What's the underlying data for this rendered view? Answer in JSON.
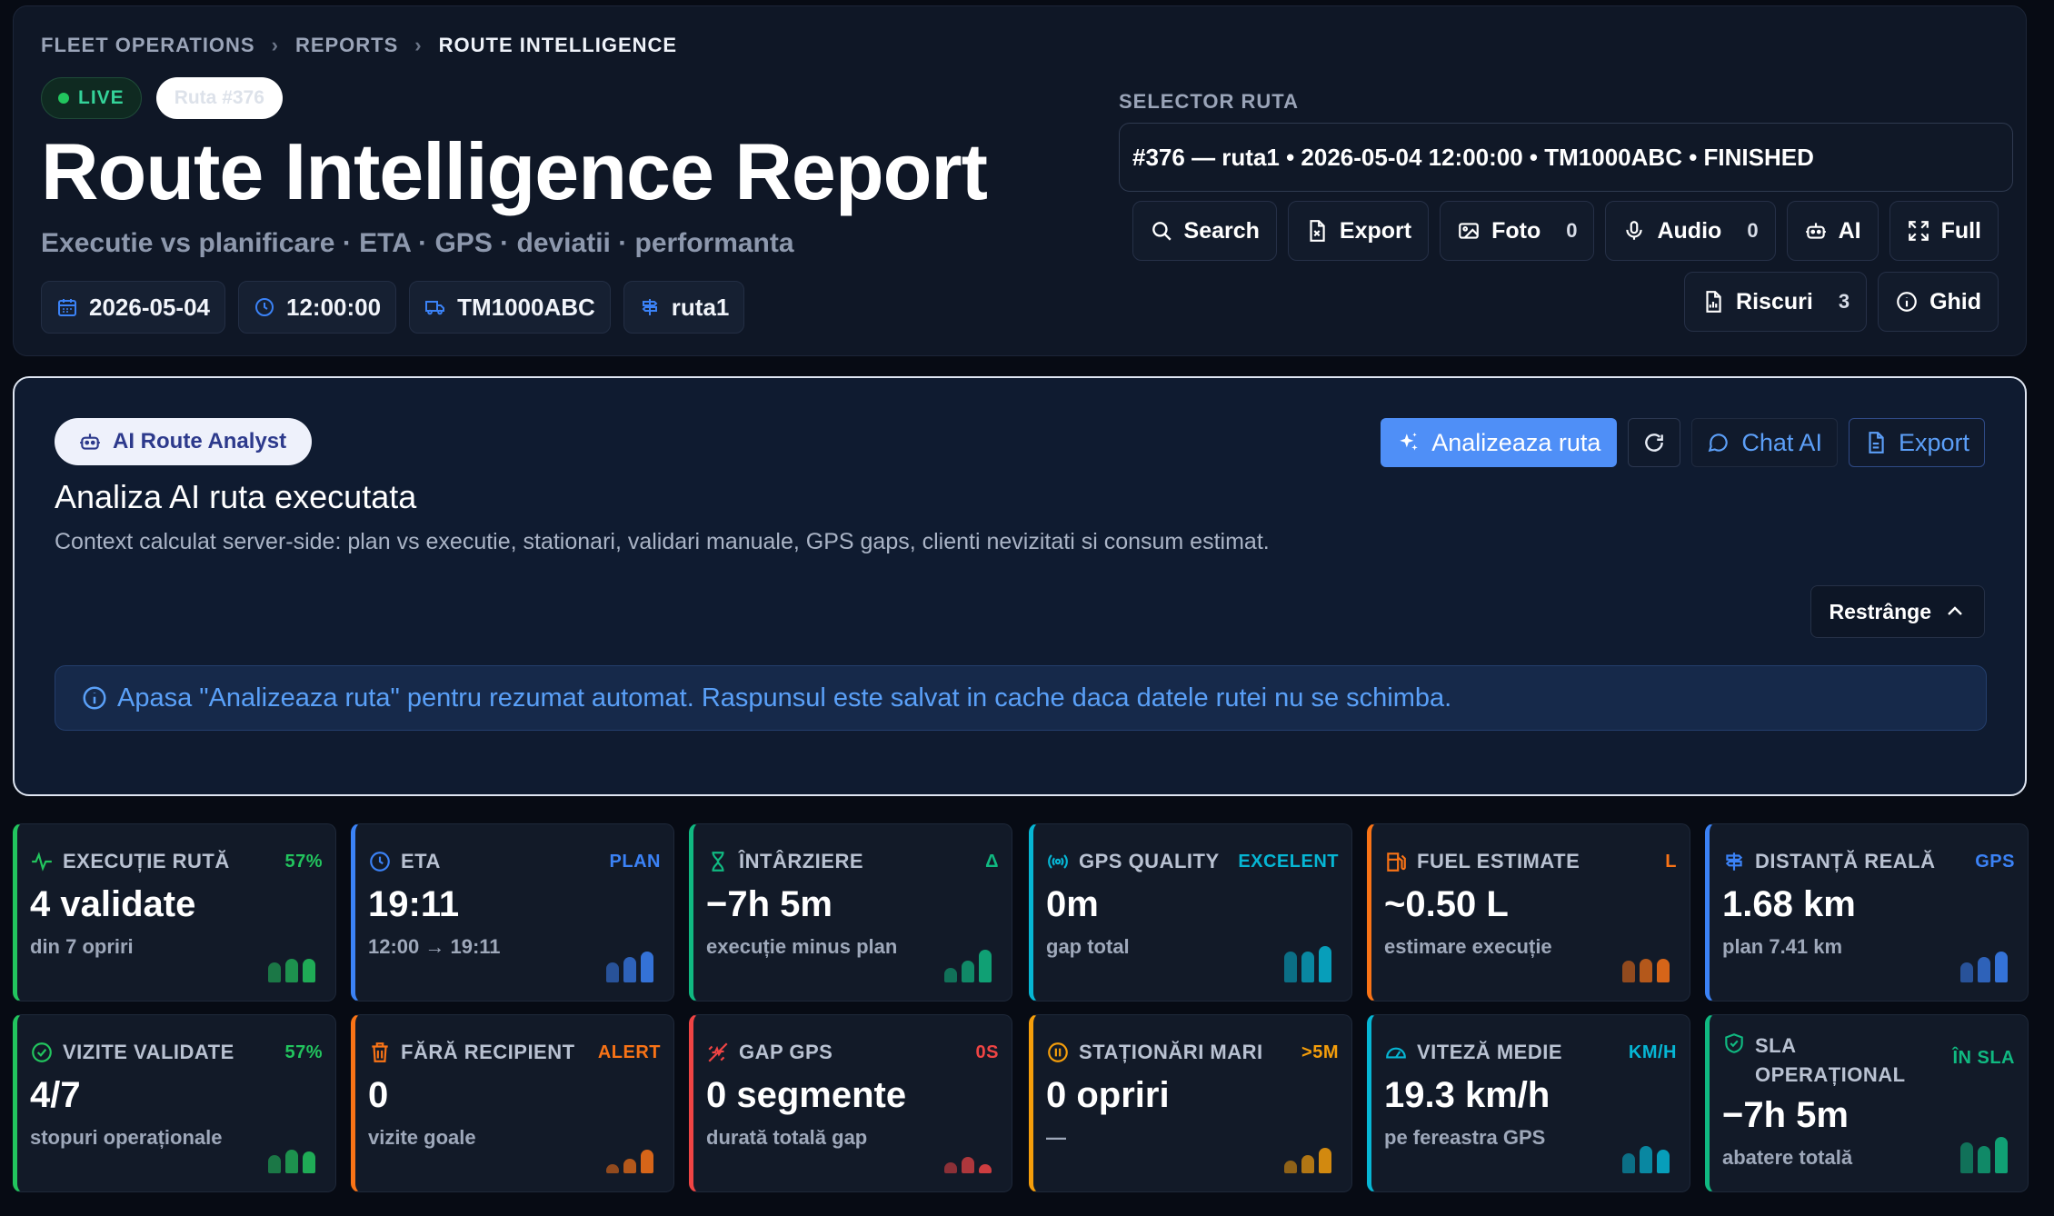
{
  "breadcrumb": [
    "FLEET OPERATIONS",
    "REPORTS",
    "ROUTE INTELLIGENCE"
  ],
  "header": {
    "live_label": "LIVE",
    "route_pill": "Ruta #376",
    "title": "Route Intelligence Report",
    "subtitle": "Executie vs planificare · ETA · GPS · deviatii · performanta",
    "chips": [
      {
        "icon": "calendar-icon",
        "label": "2026-05-04"
      },
      {
        "icon": "clock-icon",
        "label": "12:00:00"
      },
      {
        "icon": "truck-icon",
        "label": "TM1000ABC"
      },
      {
        "icon": "signpost-icon",
        "label": "ruta1"
      }
    ]
  },
  "selector": {
    "label": "SELECTOR RUTA",
    "value": "#376 — ruta1 • 2026-05-04 12:00:00 • TM1000ABC • FINISHED"
  },
  "toolbar": {
    "search": "Search",
    "export": "Export",
    "foto": "Foto",
    "foto_count": "0",
    "audio": "Audio",
    "audio_count": "0",
    "ai": "AI",
    "full": "Full",
    "riscuri": "Riscuri",
    "riscuri_count": "3",
    "ghid": "Ghid"
  },
  "ai_panel": {
    "pill": "AI Route Analyst",
    "title": "Analiza AI ruta executata",
    "description": "Context calculat server-side: plan vs executie, stationari, validari manuale, GPS gaps, clienti nevizitati si consum estimat.",
    "analyze_label": "Analizeaza ruta",
    "chat_label": "Chat AI",
    "export_label": "Export",
    "collapse_label": "Restrânge",
    "info": "Apasa \"Analizeaza ruta\" pentru rezumat automat. Raspunsul este salvat in cache daca datele rutei nu se schimba."
  },
  "cards": [
    {
      "label": "EXECUȚIE RUTĂ",
      "badge": "57%",
      "value": "4 validate",
      "sub": "din 7 opriri",
      "color": "#22c55e",
      "icon": "activity-icon"
    },
    {
      "label": "ETA",
      "badge": "PLAN",
      "value": "19:11",
      "sub": "12:00 → 19:11",
      "color": "#3b82f6",
      "icon": "clock-icon"
    },
    {
      "label": "ÎNTÂRZIERE",
      "badge": "Δ",
      "value": "−7h 5m",
      "sub": "execuție minus plan",
      "color": "#10b981",
      "icon": "hourglass-icon"
    },
    {
      "label": "GPS QUALITY",
      "badge": "EXCELENT",
      "value": "0m",
      "sub": "gap total",
      "color": "#06b6d4",
      "icon": "gps-signal-icon"
    },
    {
      "label": "FUEL ESTIMATE",
      "badge": "L",
      "value": "~0.50 L",
      "sub": "estimare execuție",
      "color": "#f97316",
      "icon": "fuel-icon"
    },
    {
      "label": "DISTANȚĂ REALĂ",
      "badge": "GPS",
      "value": "1.68 km",
      "sub": "plan 7.41 km",
      "color": "#3b82f6",
      "icon": "signpost-icon"
    },
    {
      "label": "VIZITE VALIDATE",
      "badge": "57%",
      "value": "4/7",
      "sub": "stopuri operaționale",
      "color": "#22c55e",
      "icon": "check-circle-icon"
    },
    {
      "label": "FĂRĂ RECIPIENT",
      "badge": "ALERT",
      "value": "0",
      "sub": "vizite goale",
      "color": "#f97316",
      "icon": "trash-icon"
    },
    {
      "label": "GAP GPS",
      "badge": "0S",
      "value": "0 segmente",
      "sub": "durată totală gap",
      "color": "#ef4444",
      "icon": "gps-off-icon"
    },
    {
      "label": "STAȚIONĂRI MARI",
      "badge": ">5M",
      "value": "0 opriri",
      "sub": "—",
      "color": "#f59e0b",
      "icon": "pause-circle-icon"
    },
    {
      "label": "VITEZĂ MEDIE",
      "badge": "KM/H",
      "value": "19.3 km/h",
      "sub": "pe fereastra GPS",
      "color": "#06b6d4",
      "icon": "gauge-icon"
    },
    {
      "label": "SLA OPERAȚIONAL",
      "badge": "ÎN SLA",
      "value": "−7h 5m",
      "sub": "abatere totală",
      "color": "#10b981",
      "icon": "shield-check-icon"
    }
  ]
}
